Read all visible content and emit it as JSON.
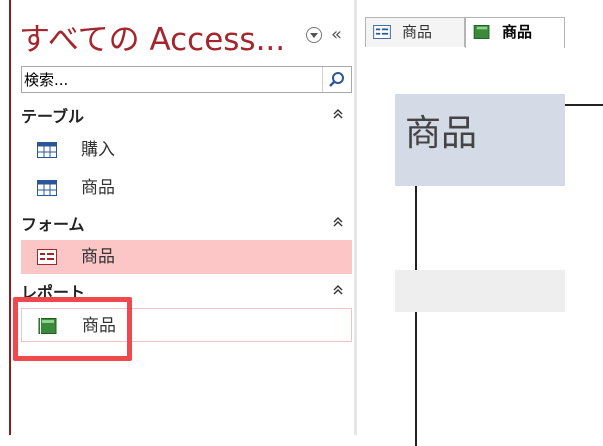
{
  "nav": {
    "title": "すべての Access...",
    "collapse_glyph": "«",
    "search_placeholder": "検索...",
    "groups": [
      {
        "label": "テーブル",
        "chevron": "⌃",
        "items": [
          {
            "label": "購入",
            "icon": "table-icon"
          },
          {
            "label": "商品",
            "icon": "table-icon"
          }
        ]
      },
      {
        "label": "フォーム",
        "chevron": "⌃",
        "items": [
          {
            "label": "商品",
            "icon": "form-icon"
          }
        ]
      },
      {
        "label": "レポート",
        "chevron": "⌃",
        "items": [
          {
            "label": "商品",
            "icon": "report-icon"
          }
        ]
      }
    ]
  },
  "tabs": [
    {
      "label": "商品",
      "icon": "form-icon",
      "active": false
    },
    {
      "label": "商品",
      "icon": "report-icon",
      "active": true
    }
  ],
  "form": {
    "title": "商品"
  },
  "colors": {
    "accent": "#a4262c",
    "selected": "#fcc5c6",
    "highlight": "#f0484c",
    "title_band": "#d5dbe6"
  }
}
